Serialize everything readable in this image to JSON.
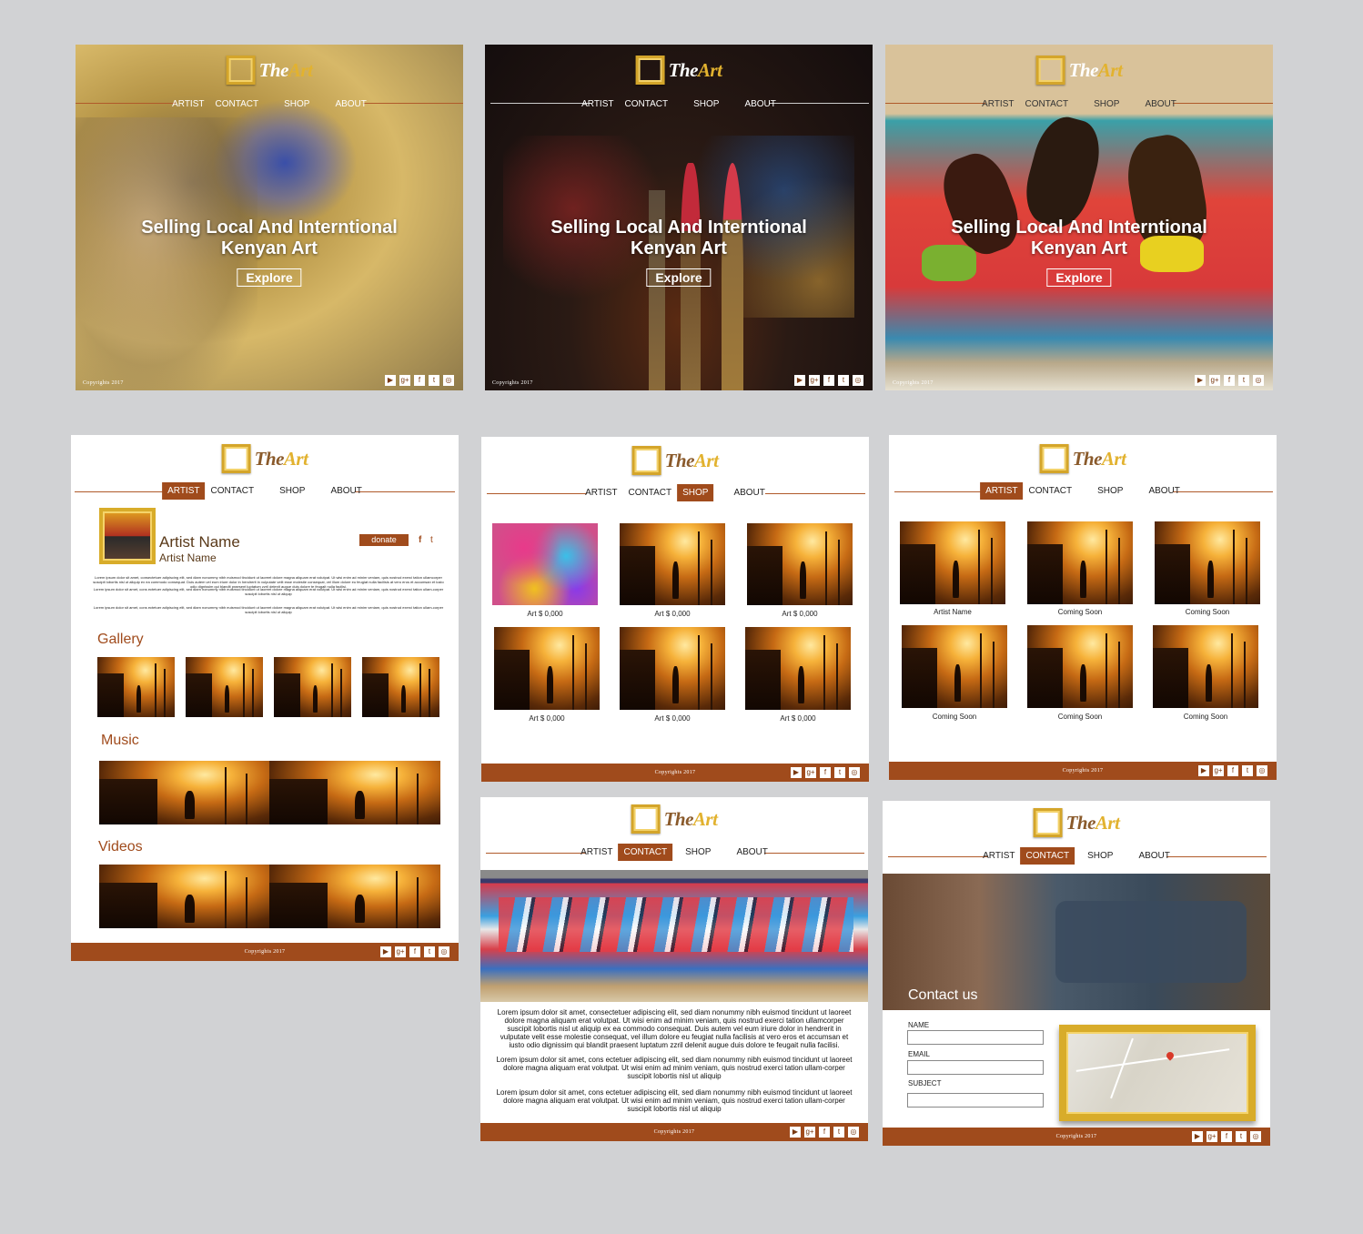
{
  "brand": {
    "the": "The",
    "art": "Art"
  },
  "nav": [
    "ARTIST",
    "CONTACT",
    "SHOP",
    "ABOUT"
  ],
  "hero": {
    "title_line1": "Selling Local And Interntional",
    "title_line2": "Kenyan Art",
    "button": "Explore"
  },
  "copyright": "Copyrights 2017",
  "social_icons": [
    "youtube-icon",
    "google-plus-icon",
    "facebook-icon",
    "twitter-icon",
    "instagram-icon"
  ],
  "social_glyphs": [
    "▶",
    "g+",
    "f",
    "t",
    "◎"
  ],
  "artist_page": {
    "name": "Artist Name",
    "subname": "Artist Name",
    "donate": "donate",
    "gallery": "Gallery",
    "music": "Music",
    "videos": "Videos"
  },
  "shop_page": {
    "captions": [
      "Art $ 0,000",
      "Art $ 0,000",
      "Art $ 0,000",
      "Art $ 0,000",
      "Art $ 0,000",
      "Art $ 0,000"
    ]
  },
  "artists_page": {
    "captions": [
      "Artist Name",
      "Coming Soon",
      "Coming Soon",
      "Coming Soon",
      "Coming Soon",
      "Coming Soon"
    ]
  },
  "about_page": {
    "p1": "Lorem ipsum dolor sit amet, consectetuer adipiscing elit, sed diam nonummy nibh euismod tincidunt ut laoreet dolore magna aliquam erat volutpat. Ut wisi enim ad minim veniam, quis nostrud exerci tation ullamcorper suscipit lobortis nisl ut aliquip ex ea commodo consequat. Duis autem vel eum iriure dolor in hendrerit in vulputate velit esse molestie consequat, vel illum dolore eu feugiat nulla facilisis at vero eros et accumsan et iusto odio dignissim qui blandit praesent luptatum zzril delenit augue duis dolore te feugait nulla facilisi.",
    "p2": "Lorem ipsum dolor sit amet, cons ectetuer adipiscing elit, sed diam nonummy nibh euismod tincidunt ut laoreet dolore magna aliquam erat volutpat. Ut wisi enim ad minim veniam, quis nostrud exerci tation ullam-corper suscipit lobortis nisl ut aliquip",
    "p3": "Lorem ipsum dolor sit amet, cons ectetuer adipiscing elit, sed diam nonummy nibh euismod tincidunt ut laoreet dolore magna aliquam erat volutpat. Ut wisi enim ad minim veniam, quis nostrud exerci tation ullam-corper suscipit lobortis nisl ut aliquip"
  },
  "contact_page": {
    "title": "Contact us",
    "name_label": "NAME",
    "email_label": "EMAIL",
    "subject_label": "SUBJECT"
  }
}
